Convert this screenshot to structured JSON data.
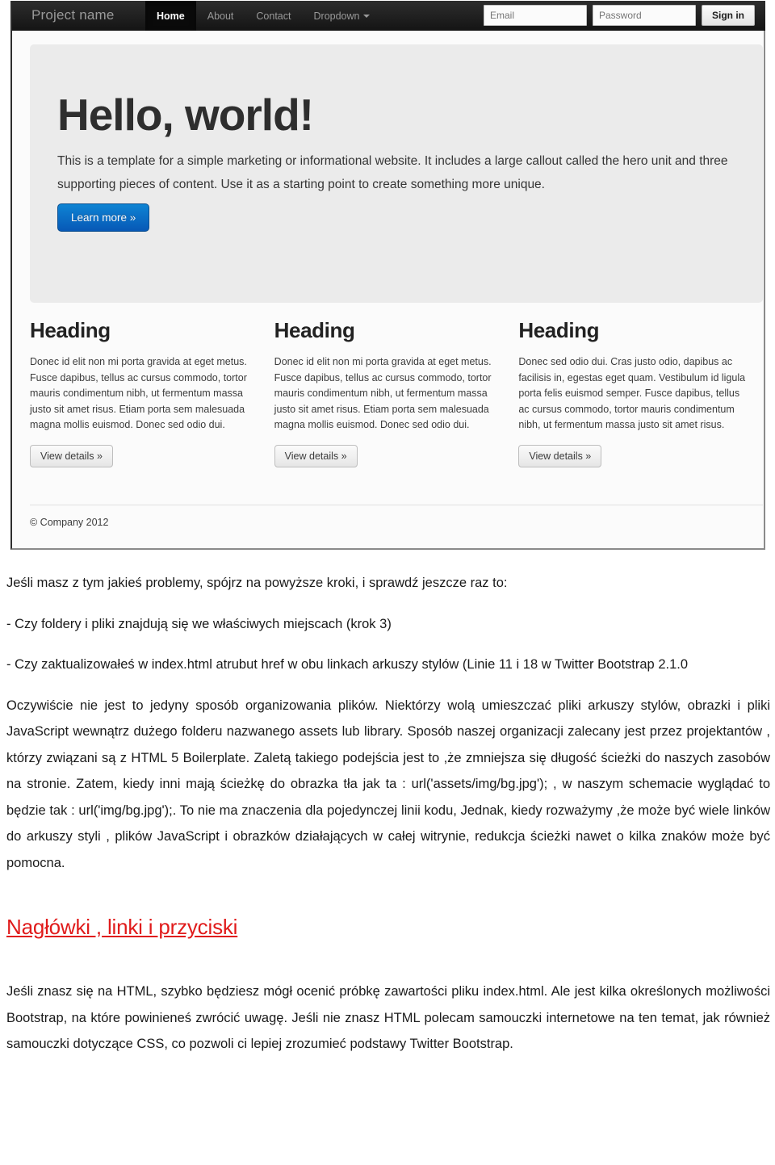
{
  "screenshot": {
    "navbar": {
      "brand": "Project name",
      "links": [
        {
          "label": "Home",
          "active": true
        },
        {
          "label": "About",
          "active": false
        },
        {
          "label": "Contact",
          "active": false
        },
        {
          "label": "Dropdown",
          "active": false,
          "caret": true
        }
      ],
      "email_placeholder": "Email",
      "password_placeholder": "Password",
      "signin_label": "Sign in"
    },
    "hero": {
      "title": "Hello, world!",
      "subtitle": "This is a template for a simple marketing or informational website. It includes a large callout called the hero unit and three supporting pieces of content. Use it as a starting point to create something more unique.",
      "button_label": "Learn more »"
    },
    "columns": [
      {
        "heading": "Heading",
        "body": "Donec id elit non mi porta gravida at eget metus. Fusce dapibus, tellus ac cursus commodo, tortor mauris condimentum nibh, ut fermentum massa justo sit amet risus. Etiam porta sem malesuada magna mollis euismod. Donec sed odio dui.",
        "button_label": "View details »"
      },
      {
        "heading": "Heading",
        "body": "Donec id elit non mi porta gravida at eget metus. Fusce dapibus, tellus ac cursus commodo, tortor mauris condimentum nibh, ut fermentum massa justo sit amet risus. Etiam porta sem malesuada magna mollis euismod. Donec sed odio dui.",
        "button_label": "View details »"
      },
      {
        "heading": "Heading",
        "body": "Donec sed odio dui. Cras justo odio, dapibus ac facilisis in, egestas eget quam. Vestibulum id ligula porta felis euismod semper. Fusce dapibus, tellus ac cursus commodo, tortor mauris condimentum nibh, ut fermentum massa justo sit amet risus.",
        "button_label": "View details »"
      }
    ],
    "footer": "© Company 2012"
  },
  "document": {
    "intro": "Jeśli masz z tym jakieś problemy, spójrz na powyższe kroki, i sprawdź jeszcze raz to:",
    "check_1": "- Czy foldery i pliki znajdują się we właściwych miejscach (krok 3)",
    "check_2": "- Czy zaktualizowałeś w index.html atrubut href w obu linkach arkuszy stylów (Linie 11 i 18 w Twitter Bootstrap 2.1.0",
    "body_1": "Oczywiście nie jest to jedyny sposób organizowania plików. Niektórzy wolą umieszczać pliki arkuszy stylów, obrazki i pliki JavaScript wewnątrz dużego folderu nazwanego assets lub library.  Sposób naszej organizacji zalecany jest przez projektantów , którzy związani są z HTML 5 Boilerplate. Zaletą takiego podejścia jest to ,że zmniejsza się długość ścieżki do naszych zasobów na stronie. Zatem, kiedy inni mają ścieżkę do obrazka tła jak ta  : url('assets/img/bg.jpg'); , w naszym schemacie wyglądać to będzie tak : url('img/bg.jpg');. To nie ma znaczenia dla pojedynczej linii kodu, Jednak, kiedy rozważymy ,że może być wiele linków do arkuszy styli , plików JavaScript i obrazków działających w całej witrynie, redukcja ścieżki nawet o kilka znaków może być pomocna.",
    "section_heading": "Nagłówki , linki i przyciski",
    "body_2": "Jeśli znasz się na HTML, szybko będziesz mógł ocenić próbkę zawartości pliku index.html. Ale jest kilka określonych możliwości Bootstrap, na które powinieneś zwrócić uwagę. Jeśli nie znasz HTML polecam samouczki internetowe na ten temat, jak również samouczki dotyczące CSS, co pozwoli ci lepiej zrozumieć podstawy Twitter Bootstrap."
  },
  "colors": {
    "navbar_bg": "#1b1b1b",
    "hero_bg": "#eeeeee",
    "primary_button": "#0357b8",
    "section_heading": "#e01b1b"
  }
}
